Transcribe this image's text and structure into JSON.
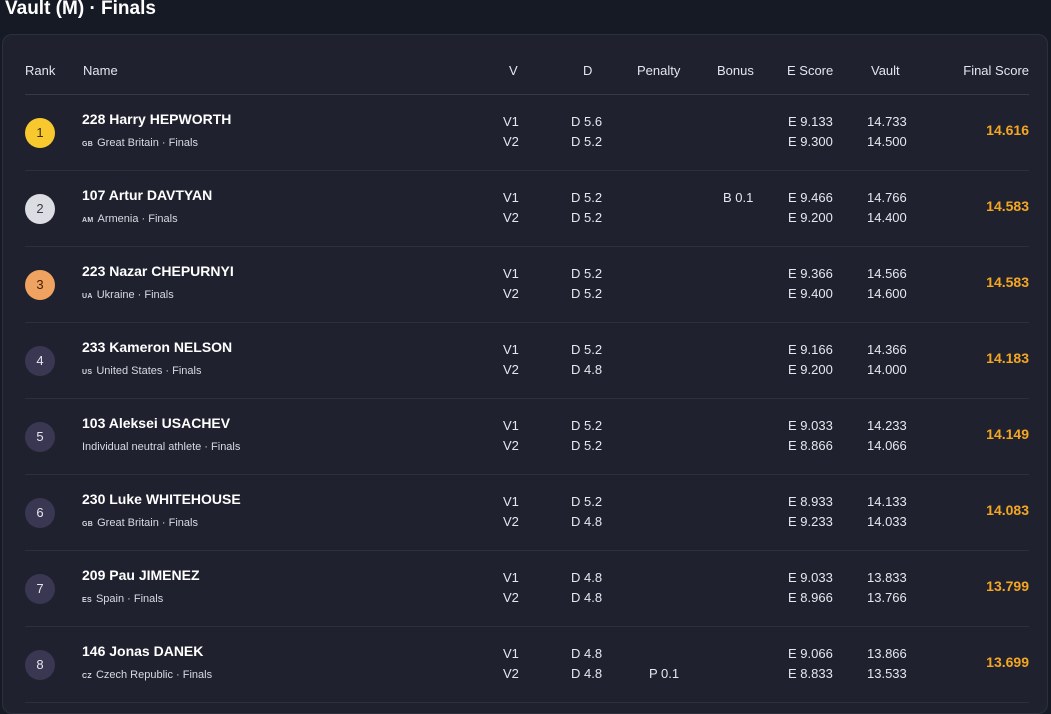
{
  "page": {
    "title": "Vault (M) · Finals"
  },
  "columns": {
    "rank": "Rank",
    "name": "Name",
    "v": "V",
    "d": "D",
    "penalty": "Penalty",
    "bonus": "Bonus",
    "e_score": "E Score",
    "vault": "Vault",
    "final_score": "Final Score"
  },
  "rows": [
    {
      "rank": "1",
      "name": "228 Harry HEPWORTH",
      "country_code": "GB",
      "country_line": "Great Britain · Finals",
      "v": [
        "V1",
        "V2"
      ],
      "d": [
        "D 5.6",
        "D 5.2"
      ],
      "penalty": [
        "",
        ""
      ],
      "bonus": [
        "",
        ""
      ],
      "e": [
        "E 9.133",
        "E 9.300"
      ],
      "vault": [
        "14.733",
        "14.500"
      ],
      "final": "14.616"
    },
    {
      "rank": "2",
      "name": "107 Artur DAVTYAN",
      "country_code": "AM",
      "country_line": "Armenia · Finals",
      "v": [
        "V1",
        "V2"
      ],
      "d": [
        "D 5.2",
        "D 5.2"
      ],
      "penalty": [
        "",
        ""
      ],
      "bonus": [
        "B 0.1",
        ""
      ],
      "e": [
        "E 9.466",
        "E 9.200"
      ],
      "vault": [
        "14.766",
        "14.400"
      ],
      "final": "14.583"
    },
    {
      "rank": "3",
      "name": "223 Nazar CHEPURNYI",
      "country_code": "UA",
      "country_line": "Ukraine · Finals",
      "v": [
        "V1",
        "V2"
      ],
      "d": [
        "D 5.2",
        "D 5.2"
      ],
      "penalty": [
        "",
        ""
      ],
      "bonus": [
        "",
        ""
      ],
      "e": [
        "E 9.366",
        "E 9.400"
      ],
      "vault": [
        "14.566",
        "14.600"
      ],
      "final": "14.583"
    },
    {
      "rank": "4",
      "name": "233 Kameron NELSON",
      "country_code": "US",
      "country_line": "United States · Finals",
      "v": [
        "V1",
        "V2"
      ],
      "d": [
        "D 5.2",
        "D 4.8"
      ],
      "penalty": [
        "",
        ""
      ],
      "bonus": [
        "",
        ""
      ],
      "e": [
        "E 9.166",
        "E 9.200"
      ],
      "vault": [
        "14.366",
        "14.000"
      ],
      "final": "14.183"
    },
    {
      "rank": "5",
      "name": "103 Aleksei USACHEV",
      "country_code": "",
      "country_line": "Individual neutral athlete · Finals",
      "v": [
        "V1",
        "V2"
      ],
      "d": [
        "D 5.2",
        "D 5.2"
      ],
      "penalty": [
        "",
        ""
      ],
      "bonus": [
        "",
        ""
      ],
      "e": [
        "E 9.033",
        "E 8.866"
      ],
      "vault": [
        "14.233",
        "14.066"
      ],
      "final": "14.149"
    },
    {
      "rank": "6",
      "name": "230 Luke WHITEHOUSE",
      "country_code": "GB",
      "country_line": "Great Britain · Finals",
      "v": [
        "V1",
        "V2"
      ],
      "d": [
        "D 5.2",
        "D 4.8"
      ],
      "penalty": [
        "",
        ""
      ],
      "bonus": [
        "",
        ""
      ],
      "e": [
        "E 8.933",
        "E 9.233"
      ],
      "vault": [
        "14.133",
        "14.033"
      ],
      "final": "14.083"
    },
    {
      "rank": "7",
      "name": "209 Pau JIMENEZ",
      "country_code": "ES",
      "country_line": "Spain · Finals",
      "v": [
        "V1",
        "V2"
      ],
      "d": [
        "D 4.8",
        "D 4.8"
      ],
      "penalty": [
        "",
        ""
      ],
      "bonus": [
        "",
        ""
      ],
      "e": [
        "E 9.033",
        "E 8.966"
      ],
      "vault": [
        "13.833",
        "13.766"
      ],
      "final": "13.799"
    },
    {
      "rank": "8",
      "name": "146 Jonas DANEK",
      "country_code": "CZ",
      "country_line": "Czech Republic · Finals",
      "v": [
        "V1",
        "V2"
      ],
      "d": [
        "D 4.8",
        "D 4.8"
      ],
      "penalty": [
        "",
        "P 0.1"
      ],
      "bonus": [
        "",
        ""
      ],
      "e": [
        "E 9.066",
        "E 8.833"
      ],
      "vault": [
        "13.866",
        "13.533"
      ],
      "final": "13.699"
    }
  ],
  "colors": {
    "background": "#161a25",
    "panel": "#1f222e",
    "final_score": "#f5a623",
    "rank_gold": "#f8c92f",
    "rank_silver": "#dcdde2",
    "rank_bronze": "#f0a260",
    "rank_default": "#393751"
  }
}
